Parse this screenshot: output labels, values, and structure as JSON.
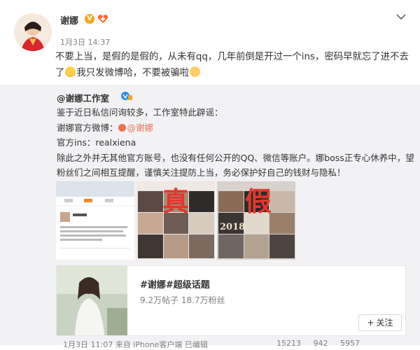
{
  "post": {
    "author": "谢娜",
    "verified_badge": "V",
    "time": "1月3日 14:37",
    "text_a": "不要上当，是假的是假的，从未有qq，几年前倒是开过一个ins，密码早就忘了进不去了",
    "text_b": "我只发微博哈，不要被骗啦",
    "emoji_icons": [
      "crying-laughing-emoji",
      "praying-hands-emoji"
    ],
    "menu_icon": "chevron-down-icon"
  },
  "repost": {
    "author": "@谢娜工作室",
    "line1": "鉴于近日私信问询较多，工作室特此辟谣：",
    "line2_prefix": "谢娜官方微博：",
    "line2_link": "@谢娜",
    "line3": "官方ins：realxiena",
    "line4a": "除此之外并无其他官方账号，也没有任何公开的QQ、微信等账户。娜boss正专心休养中，望",
    "line4b": "粉丝们之间相互提醒，谨慎关注提防上当，务必保护好自己的钱财与隐私！",
    "img_labels": {
      "true": "真",
      "fake": "假"
    },
    "img_number": "2018"
  },
  "topic": {
    "title": "#谢娜#超级话题",
    "stats": "9.2万帖子 18.7万粉丝",
    "follow_label": "关注",
    "plus": "+"
  },
  "footer": {
    "source": "1月3日 11:07 来自 iPhone客户端 已编辑",
    "reposts": "15213",
    "comments": "942",
    "likes": "5957"
  },
  "colors": {
    "accent": "#eb7350",
    "red_text": "#e3372d",
    "gray": "#808080",
    "repost_bg": "#f2f2f5"
  }
}
